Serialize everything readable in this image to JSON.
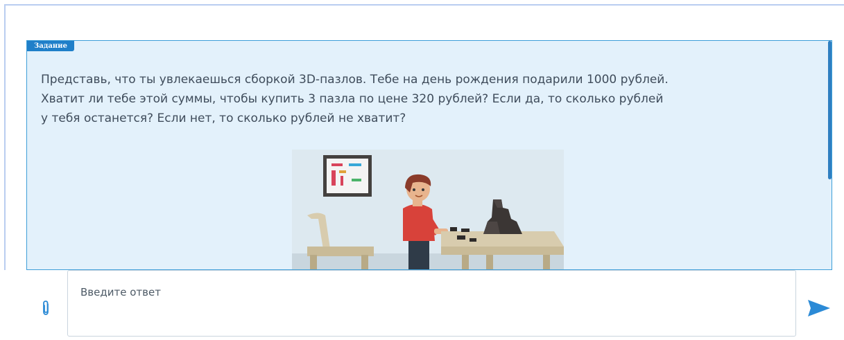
{
  "task": {
    "badge_label": "Задание",
    "text_lines": [
      "Представь, что ты увлекаешься сборкой 3D-пазлов. Тебе на день рождения подарили 1000 рублей.",
      "Хватит ли тебе этой суммы, чтобы купить 3 пазла по цене 320 рублей? Если да, то сколько рублей",
      "у тебя останется? Если нет, то сколько рублей не хватит?"
    ],
    "illustration": "boy-with-3d-puzzle-illustration"
  },
  "answer": {
    "placeholder": "Введите ответ",
    "value": ""
  },
  "icons": {
    "attach": "paperclip-icon",
    "send": "send-arrow-icon"
  },
  "colors": {
    "card_bg": "#e3f1fb",
    "card_border": "#3d9ed8",
    "badge_bg": "#1f7fc9",
    "send": "#2b8ad6"
  }
}
